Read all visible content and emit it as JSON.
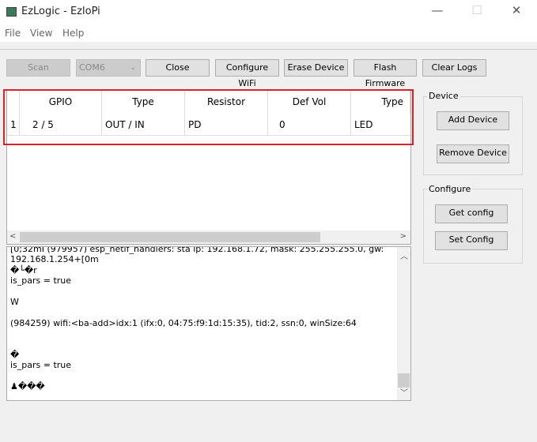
{
  "window": {
    "title": "EzLogic - EzloPi",
    "minimize": "—",
    "maximize": "☐",
    "close": "✕"
  },
  "menu": [
    "File",
    "View",
    "Help"
  ],
  "toolbar": {
    "scan": "Scan",
    "port": "COM6",
    "close": "Close",
    "configure_wifi": "Configure WiFi",
    "erase": "Erase Device",
    "flash": "Flash Firmware",
    "clear_logs": "Clear Logs"
  },
  "table": {
    "columns": [
      "GPIO",
      "Type",
      "Resistor",
      "Def Vol",
      "Type"
    ],
    "rows": [
      {
        "index": "1",
        "cells": [
          "2 / 5",
          "OUT / IN",
          "PD",
          "0",
          "LED"
        ]
      }
    ]
  },
  "log": {
    "text": "[0;32mI (979957) esp_netif_handlers: sta ip: 192.168.1.72, mask: 255.255.255.0, gw:\n192.168.1.254+[0m\n�└�r\nis_pars = true\n\nW\n\n(984259) wifi:<ba-add>idx:1 (ifx:0, 04:75:f9:1d:15:35), tid:2, ssn:0, winSize:64\n\n\n�\nis_pars = true\n\n♟���"
  },
  "device": {
    "label": "Device",
    "add": "Add Device",
    "remove": "Remove Device"
  },
  "configure": {
    "label": "Configure",
    "get": "Get config",
    "set": "Set Config"
  },
  "highlight_color": "#d9232b"
}
